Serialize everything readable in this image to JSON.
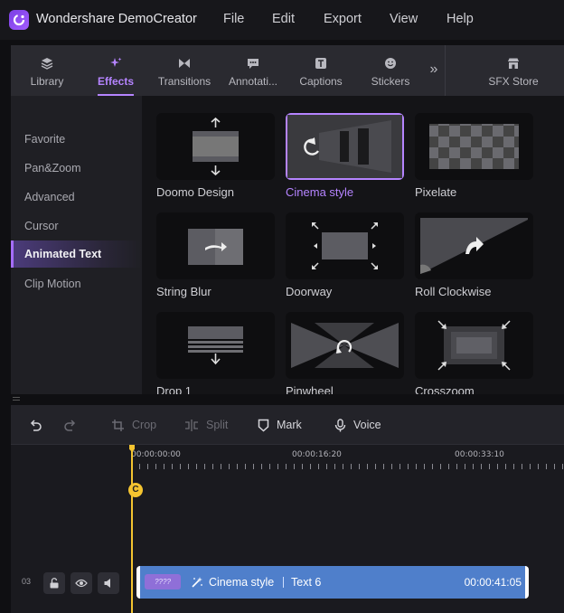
{
  "app": {
    "title": "Wondershare DemoCreator"
  },
  "menu": [
    "File",
    "Edit",
    "Export",
    "View",
    "Help"
  ],
  "tabs": [
    {
      "label": "Library",
      "icon": "layers-icon"
    },
    {
      "label": "Effects",
      "icon": "sparkle-icon",
      "active": true
    },
    {
      "label": "Transitions",
      "icon": "bowtie-icon"
    },
    {
      "label": "Annotati...",
      "icon": "speech-bubble-icon"
    },
    {
      "label": "Captions",
      "icon": "caption-icon"
    },
    {
      "label": "Stickers",
      "icon": "smiley-icon"
    },
    {
      "label": "SFX Store",
      "icon": "store-icon"
    }
  ],
  "more_tabs": "»",
  "sidebar": {
    "items": [
      {
        "label": "Favorite"
      },
      {
        "label": "Pan&Zoom"
      },
      {
        "label": "Advanced"
      },
      {
        "label": "Cursor"
      },
      {
        "label": "Animated Text",
        "active": true
      },
      {
        "label": "Clip Motion"
      }
    ]
  },
  "effects": [
    {
      "label": "Doomo Design"
    },
    {
      "label": "Cinema style",
      "selected": true
    },
    {
      "label": "Pixelate"
    },
    {
      "label": "String Blur"
    },
    {
      "label": "Doorway"
    },
    {
      "label": "Roll Clockwise"
    },
    {
      "label": "Drop 1"
    },
    {
      "label": "Pinwheel"
    },
    {
      "label": "Crosszoom"
    }
  ],
  "toolbar": {
    "crop": "Crop",
    "split": "Split",
    "mark": "Mark",
    "voice": "Voice"
  },
  "ruler": {
    "labels": [
      "00:00:00:00",
      "00:00:16:20",
      "00:00:33:10"
    ]
  },
  "marker": {
    "label": "C"
  },
  "track": {
    "number": "03",
    "clip": {
      "thumb_text": "????",
      "effect": "Cinema style",
      "text": "Text 6",
      "duration": "00:00:41:05"
    }
  },
  "colors": {
    "accent": "#b584ff",
    "clip": "#4f7fcb",
    "playhead": "#f4c430"
  }
}
